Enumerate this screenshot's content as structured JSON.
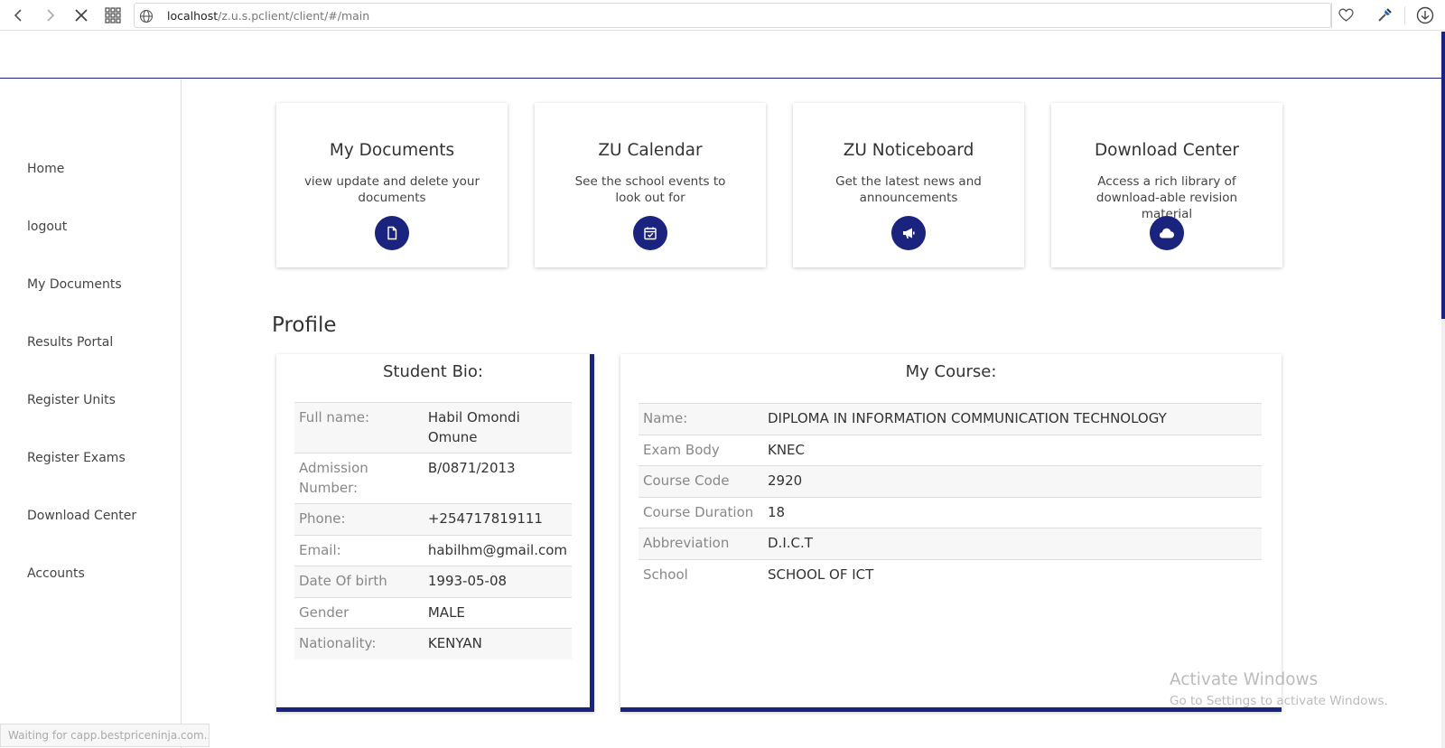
{
  "browser": {
    "url_host": "localhost",
    "url_path": "/z.u.s.pclient/client/#/main"
  },
  "sidebar": {
    "items": [
      {
        "label": "Home"
      },
      {
        "label": "logout"
      },
      {
        "label": "My Documents"
      },
      {
        "label": "Results Portal"
      },
      {
        "label": "Register Units"
      },
      {
        "label": "Register Exams"
      },
      {
        "label": "Download Center"
      },
      {
        "label": "Accounts"
      }
    ]
  },
  "cards": [
    {
      "title": "My Documents",
      "desc": "view update and delete your documents",
      "icon": "file-icon"
    },
    {
      "title": "ZU Calendar",
      "desc": "See the school events to look out for",
      "icon": "calendar-check-icon"
    },
    {
      "title": "ZU Noticeboard",
      "desc": "Get the latest news and announcements",
      "icon": "bullhorn-icon"
    },
    {
      "title": "Download Center",
      "desc": "Access a rich library of download-able revision material",
      "icon": "cloud-icon"
    }
  ],
  "profile": {
    "heading": "Profile",
    "bio": {
      "title": "Student Bio:",
      "rows": [
        {
          "label": "Full name:",
          "value": "Habil Omondi Omune"
        },
        {
          "label": "Admission Number:",
          "value": "B/0871/2013"
        },
        {
          "label": "Phone:",
          "value": "+254717819111"
        },
        {
          "label": "Email:",
          "value": "habilhm@gmail.com"
        },
        {
          "label": "Date Of birth",
          "value": "1993-05-08"
        },
        {
          "label": "Gender",
          "value": "MALE"
        },
        {
          "label": "Nationality:",
          "value": "KENYAN"
        }
      ]
    },
    "course": {
      "title": "My Course:",
      "rows": [
        {
          "label": "Name:",
          "value": "DIPLOMA IN INFORMATION COMMUNICATION TECHNOLOGY"
        },
        {
          "label": "Exam Body",
          "value": "KNEC"
        },
        {
          "label": "Course Code",
          "value": "2920"
        },
        {
          "label": "Course Duration",
          "value": "18"
        },
        {
          "label": "Abbreviation",
          "value": "D.I.C.T"
        },
        {
          "label": "School",
          "value": "SCHOOL OF ICT"
        }
      ]
    }
  },
  "status_text": "Waiting for capp.bestpriceninja.com...",
  "watermark": {
    "line1": "Activate Windows",
    "line2": "Go to Settings to activate Windows."
  },
  "colors": {
    "accent": "#1a237e"
  }
}
